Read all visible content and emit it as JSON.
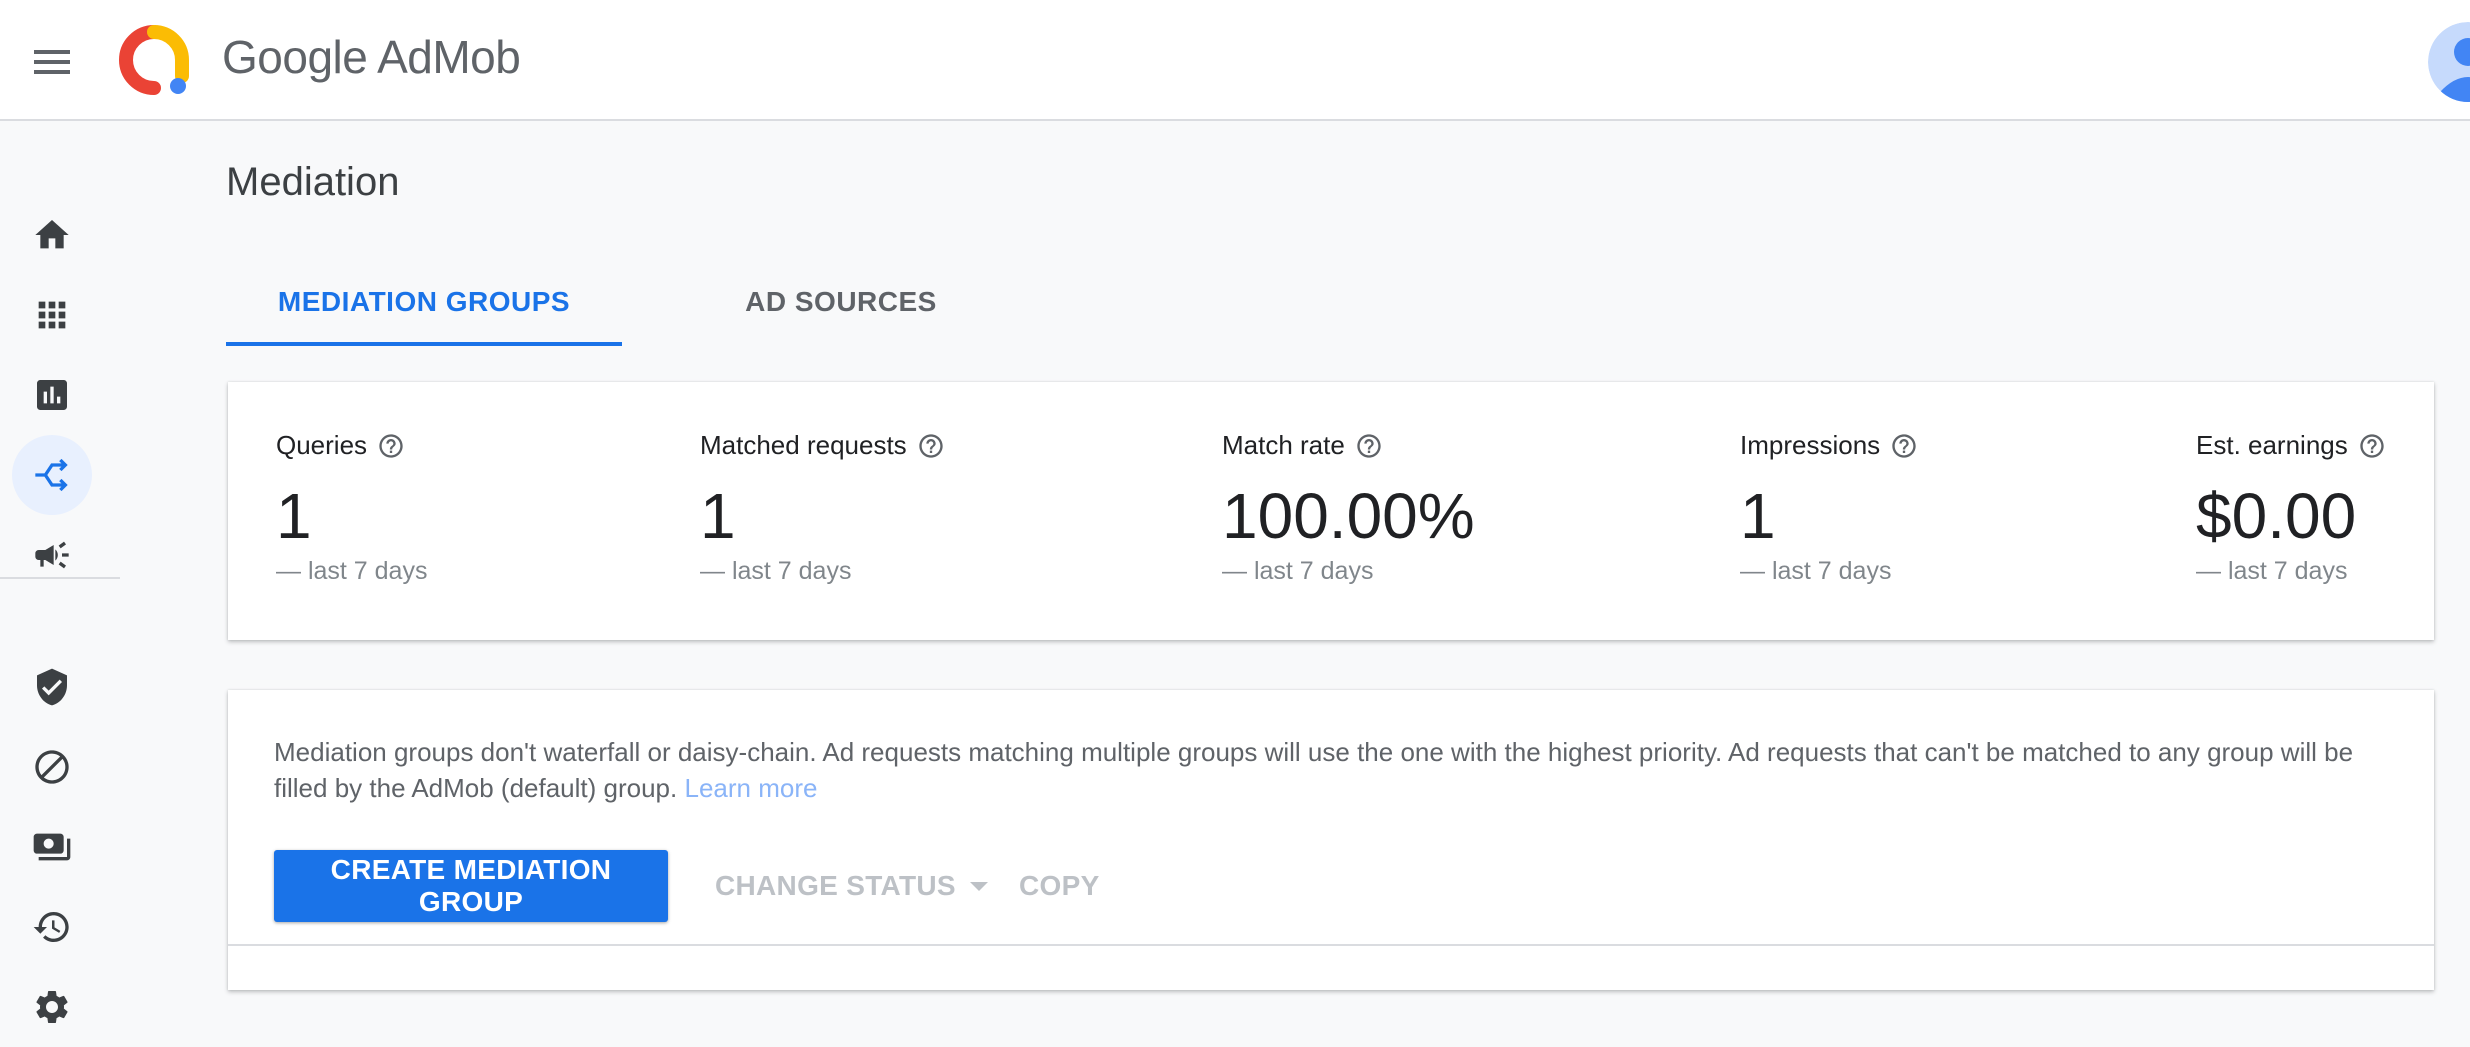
{
  "header": {
    "brand_google": "Google",
    "brand_admob": "AdMob"
  },
  "sidebar": {
    "items": [
      {
        "icon": "home-icon"
      },
      {
        "icon": "apps-icon"
      },
      {
        "icon": "reports-icon"
      },
      {
        "icon": "mediation-icon",
        "active": true
      },
      {
        "icon": "campaigns-icon"
      },
      {
        "icon": "policy-shield-icon"
      },
      {
        "icon": "blocking-controls-icon"
      },
      {
        "icon": "payments-icon"
      },
      {
        "icon": "change-history-icon"
      },
      {
        "icon": "settings-gear-icon"
      }
    ]
  },
  "page": {
    "title": "Mediation"
  },
  "tabs": [
    {
      "label": "MEDIATION GROUPS",
      "active": true
    },
    {
      "label": "AD SOURCES",
      "active": false
    }
  ],
  "stats": [
    {
      "label": "Queries",
      "value": "1",
      "period": "— last 7 days"
    },
    {
      "label": "Matched requests",
      "value": "1",
      "period": "— last 7 days"
    },
    {
      "label": "Match rate",
      "value": "100.00%",
      "period": "— last 7 days"
    },
    {
      "label": "Impressions",
      "value": "1",
      "period": "— last 7 days"
    },
    {
      "label": "Est. earnings",
      "value": "$0.00",
      "period": "— last 7 days"
    }
  ],
  "groups": {
    "info_text": "Mediation groups don't waterfall or daisy-chain. Ad requests matching multiple groups will use the one with the highest priority. Ad requests that can't be matched to any group will be filled by the AdMob (default) group.",
    "learn_more": "Learn more",
    "create_button": "CREATE MEDIATION GROUP",
    "change_status": "CHANGE STATUS",
    "copy": "COPY"
  },
  "colors": {
    "primary": "#1a73e8",
    "active_nav_bg": "#e8f0fe",
    "disabled_text": "#bdc1c6",
    "link": "#8ab4f8"
  }
}
